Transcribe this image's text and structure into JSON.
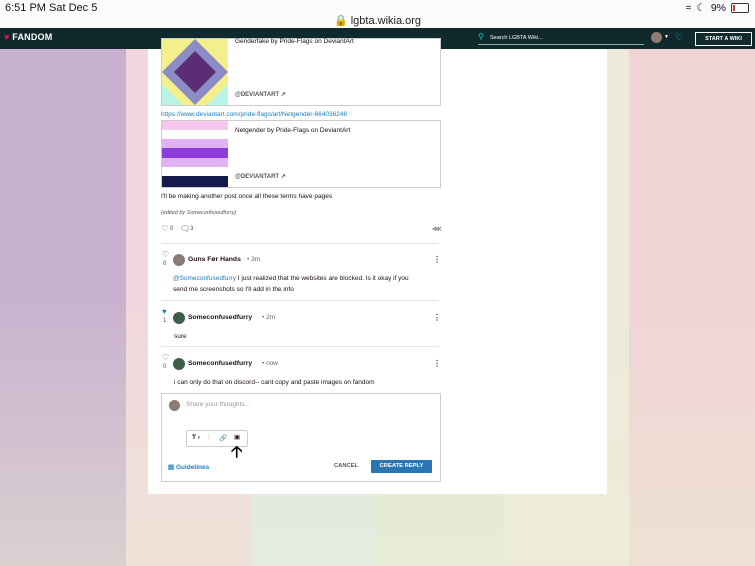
{
  "statusbar": {
    "time": "6:51 PM   Sat Dec 5",
    "url": "lgbta.wikia.org",
    "battery": "9%"
  },
  "header": {
    "logo": "FANDOM",
    "search_placeholder": "Search LGBTA Wiki...",
    "start_wiki": "START A WIKI"
  },
  "post": {
    "card1": {
      "title": "Genderfake by Pride-Flags on DeviantArt",
      "source": "@DEVIANTART"
    },
    "link2": "https://www.deviantart.com/pride-flags/art/Netgender-664036248",
    "card2": {
      "title": "Netgender by Pride-Flags on DeviantArt",
      "source": "@DEVIANTART"
    },
    "body": "I'll be making another post once all these terms have pages",
    "edited": "(edited by Someconfusedfurry)",
    "likes": "0",
    "replies": "3"
  },
  "replies": [
    {
      "user": "Guns Før Hands",
      "time": "• 3m",
      "likes": "0",
      "mention": "@Someconfusedfurry",
      "text": " I just realized that the websites are blocked. Is it okay if you",
      "text2": "send me screenshots so I'll add in the info"
    },
    {
      "user": "Someconfusedfurry",
      "time": "• 2m",
      "likes": "1",
      "text": "sure"
    },
    {
      "user": "Someconfusedfurry",
      "time": "• now",
      "likes": "0",
      "text": "i can only do that on discord-- cant copy and paste images on fandom"
    }
  ],
  "editor": {
    "placeholder": "Share your thoughts...",
    "guidelines": "Guidelines",
    "cancel": "CANCEL",
    "create": "CREATE REPLY"
  },
  "colors": {
    "fandom_bar": "#10292c",
    "accent": "#00d6d6",
    "primary_button": "#2a76b3",
    "link": "#1a7ebc"
  }
}
